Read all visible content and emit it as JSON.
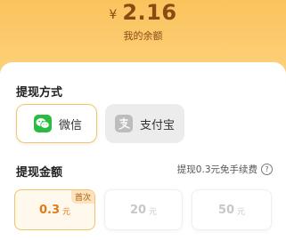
{
  "balance": {
    "currency_symbol": "¥",
    "amount": "2.16",
    "label": "我的余额"
  },
  "withdraw_method": {
    "title": "提现方式",
    "options": [
      {
        "label": "微信",
        "icon": "wechat-icon",
        "selected": true
      },
      {
        "label": "支付宝",
        "icon": "alipay-icon",
        "selected": false
      }
    ]
  },
  "withdraw_amount": {
    "title": "提现金额",
    "fee_note": "提现0.3元免手续费",
    "help_glyph": "?",
    "options": [
      {
        "value": "0.3",
        "unit": "元",
        "tag": "首次",
        "selected": true
      },
      {
        "value": "20",
        "unit": "元",
        "selected": false
      },
      {
        "value": "50",
        "unit": "元",
        "selected": false
      }
    ]
  },
  "colors": {
    "header_bg": "#fbc35d",
    "accent": "#e07b1a",
    "wechat_green": "#2bbb43"
  }
}
